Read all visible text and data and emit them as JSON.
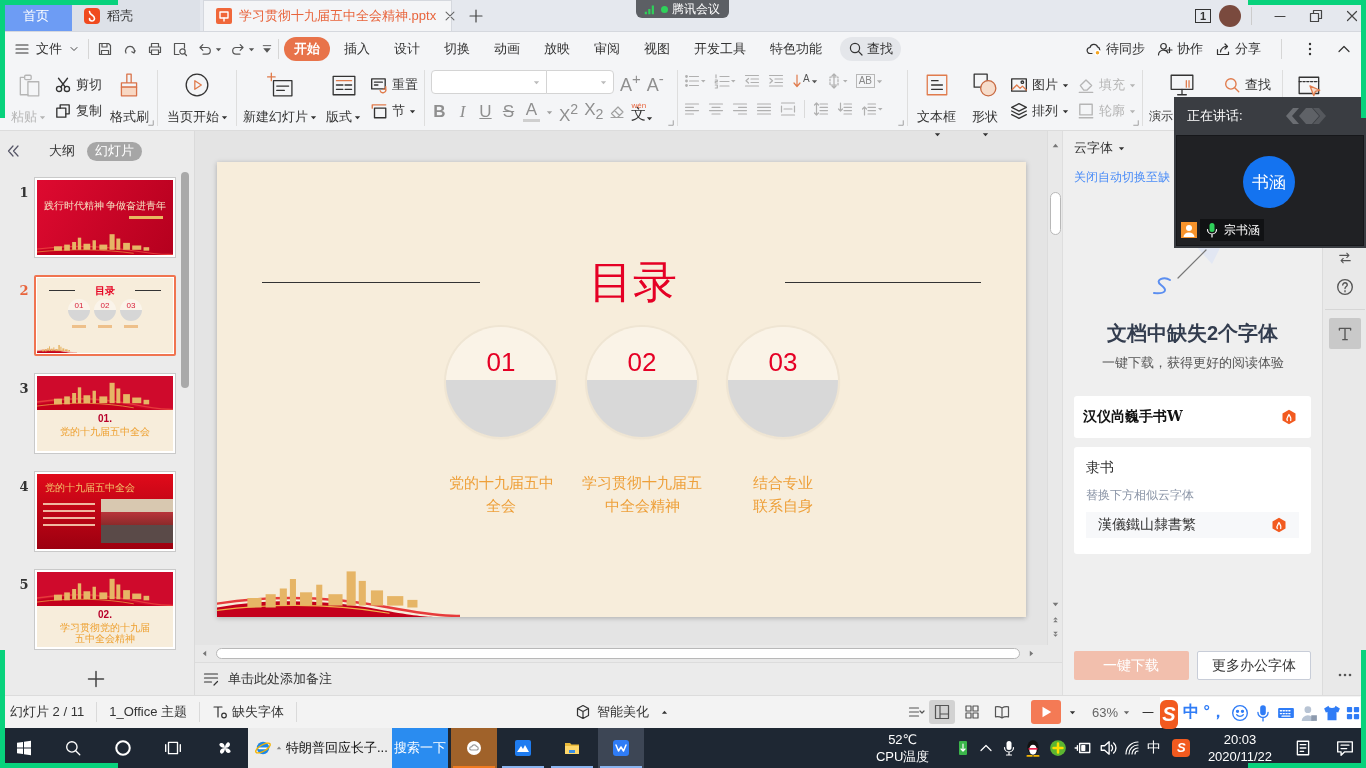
{
  "title_bar": {
    "tabs": [
      {
        "label": "首页",
        "kind": "home",
        "selected": false
      },
      {
        "label": "稻壳",
        "kind": "docer",
        "selected": false
      },
      {
        "label": "学习贯彻十九届五中全会精神.pptx",
        "kind": "document",
        "selected": true
      }
    ],
    "meeting_pill": "腾讯会议",
    "window_count": "1"
  },
  "menu": {
    "file": "文件",
    "tabs": [
      {
        "label": "开始",
        "selected": true
      },
      {
        "label": "插入",
        "selected": false
      },
      {
        "label": "设计",
        "selected": false
      },
      {
        "label": "切换",
        "selected": false
      },
      {
        "label": "动画",
        "selected": false
      },
      {
        "label": "放映",
        "selected": false
      },
      {
        "label": "审阅",
        "selected": false
      },
      {
        "label": "视图",
        "selected": false
      },
      {
        "label": "开发工具",
        "selected": false
      },
      {
        "label": "特色功能",
        "selected": false
      }
    ],
    "search": "查找",
    "actions": [
      "待同步",
      "协作",
      "分享"
    ]
  },
  "ribbon": {
    "clipboard": [
      {
        "label": "粘贴",
        "disabled": true
      },
      {
        "label": "剪切",
        "disabled": false
      },
      {
        "label": "复制",
        "disabled": false
      },
      {
        "label": "格式刷",
        "disabled": false
      }
    ],
    "play_from_current": "当页开始",
    "slides": [
      "新建幻灯片",
      "版式",
      "重置",
      "节"
    ],
    "font_size_buttons": [
      {
        "label": "A$^{+}$",
        "disabled": true
      },
      {
        "label": "A$^{-}$",
        "disabled": true
      }
    ],
    "font_style_buttons": [
      {
        "label": "B",
        "disabled": true
      },
      {
        "label": "I",
        "disabled": true
      },
      {
        "label": "U",
        "disabled": true
      },
      {
        "label": "S",
        "disabled": true
      },
      {
        "label": "A",
        "disabled": true
      },
      {
        "label": "X$^{2}$",
        "disabled": true
      },
      {
        "label": "X$_{2}$",
        "disabled": true
      }
    ],
    "phonetic": {
      "pinyin": "wén",
      "char": "文"
    },
    "sort_glyph": "A",
    "text_direction_glyph": "AB",
    "insert": [
      {
        "label": "文本框",
        "disabled": false
      },
      {
        "label": "形状",
        "disabled": false
      },
      {
        "label": "图片",
        "disabled": false
      },
      {
        "label": "排列",
        "disabled": false
      },
      {
        "label": "填充",
        "disabled": true
      },
      {
        "label": "轮廓",
        "disabled": true
      }
    ],
    "tools": [
      "演示",
      "查找"
    ]
  },
  "meeting": {
    "status": "正在讲话:",
    "avatar": "书涵",
    "speaker": "宗书涵"
  },
  "slide_pane": {
    "views": [
      {
        "label": "大纲",
        "selected": false
      },
      {
        "label": "幻灯片",
        "selected": true
      }
    ],
    "thumbnails": [
      {
        "number": "1",
        "kind": "cover",
        "selected": false,
        "title": "践行时代精神 争做奋进青年"
      },
      {
        "number": "2",
        "kind": "contents",
        "selected": true,
        "title": "目录",
        "items": [
          "01",
          "02",
          "03"
        ]
      },
      {
        "number": "3",
        "kind": "section",
        "selected": false,
        "heading": "01.",
        "title": "党的十九届五中全会"
      },
      {
        "number": "4",
        "kind": "article",
        "selected": false,
        "title": "党的十九届五中全会"
      },
      {
        "number": "5",
        "kind": "section",
        "selected": false,
        "heading": "02.",
        "title": "学习贯彻党的十九届五中全会精神"
      }
    ]
  },
  "slide": {
    "title": "目录",
    "items": [
      {
        "number": "01",
        "caption": "党的十九届五中全会"
      },
      {
        "number": "02",
        "caption": "学习贯彻十九届五中全会精神"
      },
      {
        "number": "03",
        "caption": "结合专业联系自身"
      }
    ]
  },
  "notes": {
    "placeholder": "单击此处添加备注"
  },
  "font_panel": {
    "header": "云字体",
    "link": "关闭自动切换至缺",
    "heading": "文档中缺失2个字体",
    "subheading": "一键下载，获得更好的阅读体验",
    "fonts": [
      {
        "kind": "download",
        "sample": "汉仪尚巍手书W"
      },
      {
        "kind": "replace",
        "name": "隶书",
        "hint": "替换下方相似云字体",
        "sample": "漢儀鐵山隸書繁"
      }
    ],
    "buttons": [
      {
        "label": "一键下载",
        "disabled": true
      },
      {
        "label": "更多办公字体",
        "disabled": false
      }
    ]
  },
  "side_tools": [
    {
      "selected": false
    },
    {
      "selected": false
    },
    {
      "selected": true
    }
  ],
  "status_bar": {
    "slide": "幻灯片 2 / 11",
    "theme": "1_Office 主题",
    "missing_fonts": "缺失字体",
    "beautify": "智能美化",
    "views": [
      {
        "selected": true
      },
      {
        "selected": false
      },
      {
        "selected": false
      }
    ],
    "zoom": "63%"
  },
  "ime": {
    "logo": "S",
    "mode": "中",
    "punctuation": "°，"
  },
  "taskbar": {
    "search_text": "特朗普回应长子...",
    "search_button": "搜索一下",
    "apps": [
      {
        "running": true,
        "active": false,
        "attention": true
      },
      {
        "running": true,
        "active": false,
        "attention": false
      },
      {
        "running": true,
        "active": false,
        "attention": false
      },
      {
        "running": true,
        "active": true,
        "attention": false
      }
    ],
    "temperature": "52℃",
    "temperature_label": "CPU温度",
    "tray_ime": "中",
    "tray_logo": "S",
    "time": "20:03",
    "date": "2020/11/22"
  }
}
